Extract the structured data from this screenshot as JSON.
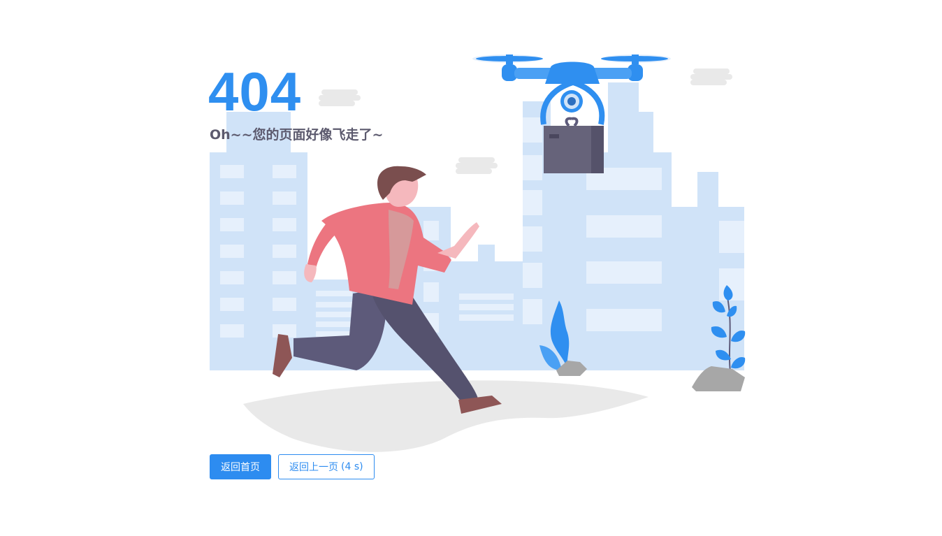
{
  "error": {
    "code": "404",
    "message": "Oh~~您的页面好像飞走了~"
  },
  "actions": {
    "home_label": "返回首页",
    "back_label": "返回上一页",
    "countdown": "(4 s)"
  },
  "colors": {
    "accent": "#2d8cf0",
    "building": "#d0e3f8",
    "window": "#e6f0fc",
    "ground": "#e9e9e9",
    "shirt": "#ec7580",
    "pants": "#5d5a7a",
    "box": "#66637a",
    "rock": "#a7a7a7"
  },
  "illustration": {
    "icons": [
      "city-buildings",
      "drone-icon",
      "package-box",
      "running-man",
      "plant-icon",
      "cloud-icon",
      "rock-icon"
    ]
  }
}
